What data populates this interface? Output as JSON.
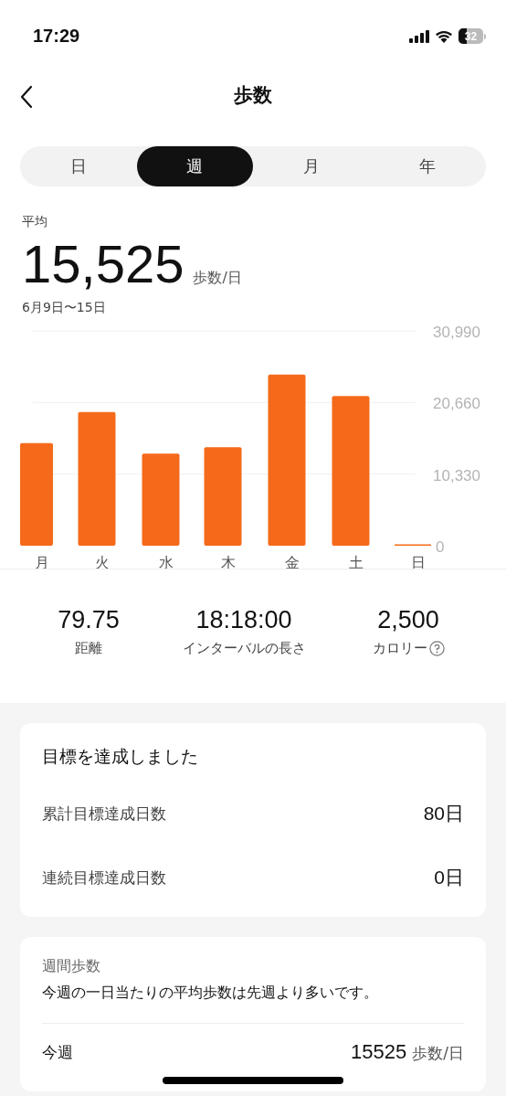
{
  "status_bar": {
    "time": "17:29",
    "battery": "32"
  },
  "header": {
    "title": "歩数"
  },
  "tabs": [
    {
      "label": "日",
      "selected": false
    },
    {
      "label": "週",
      "selected": true
    },
    {
      "label": "月",
      "selected": false
    },
    {
      "label": "年",
      "selected": false
    }
  ],
  "summary": {
    "label": "平均",
    "value": "15,525",
    "unit": "歩数/日",
    "range": "6月9日〜15日"
  },
  "chart_data": {
    "type": "bar",
    "categories": [
      "月",
      "火",
      "水",
      "木",
      "金",
      "土",
      "日"
    ],
    "series": [
      {
        "color": "#f56a1a",
        "values": [
          14800,
          19300,
          13300,
          14200,
          24700,
          21600,
          0
        ]
      }
    ],
    "ylim": [
      0,
      30990
    ],
    "yticks": [
      0,
      {
        "value": 10330,
        "label": "10,330"
      },
      {
        "value": 20660,
        "label": "20,660"
      },
      {
        "value": 30990,
        "label": "30,990"
      }
    ]
  },
  "stats": [
    {
      "value": "79.75",
      "label": "距離",
      "help": false
    },
    {
      "value": "18:18:00",
      "label": "インターバルの長さ",
      "help": false
    },
    {
      "value": "2,500",
      "label": "カロリー",
      "help": true
    }
  ],
  "goal_card": {
    "title": "目標を達成しました",
    "rows": [
      {
        "label": "累計目標達成日数",
        "value": "80日"
      },
      {
        "label": "連続目標達成日数",
        "value": "0日"
      }
    ]
  },
  "weekly_card": {
    "title": "週間歩数",
    "message": "今週の一日当たりの平均歩数は先週より多いです。",
    "rows": [
      {
        "label": "今週",
        "value": "15525",
        "unit": "歩数/日"
      }
    ]
  }
}
